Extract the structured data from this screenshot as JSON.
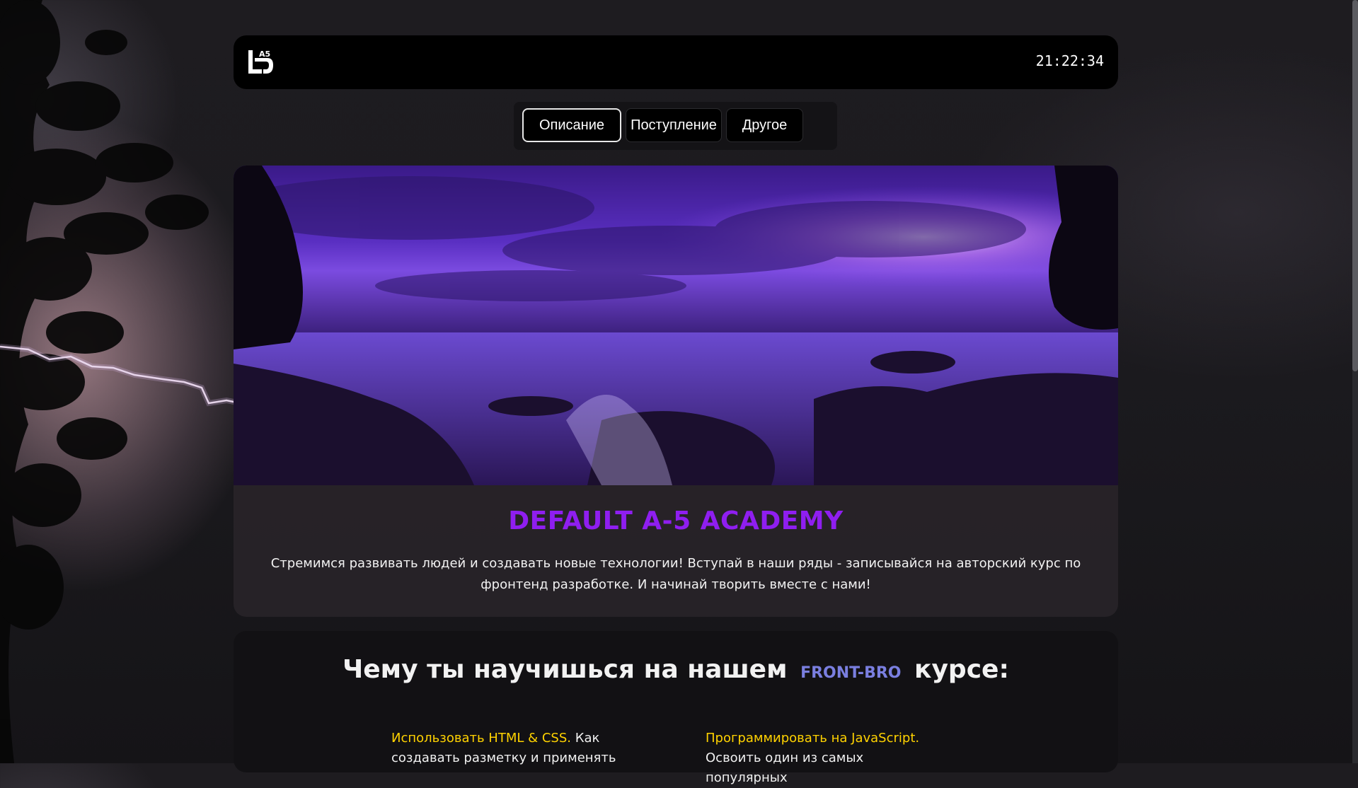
{
  "header": {
    "logo_icon": "a5-academy-logo-icon",
    "clock": "21:22:34"
  },
  "tabs": [
    {
      "label": "Описание",
      "active": true
    },
    {
      "label": "Поступление",
      "active": false
    },
    {
      "label": "Другое",
      "active": false
    }
  ],
  "hero": {
    "image": "purple-sunset-rocky-shore",
    "title": "DEFAULT A-5 ACADEMY",
    "text": "Стремимся развивать людей и создавать новые технологии! Вступай в наши ряды - записывайся на авторский курс по фронтенд разработке. И начинай творить вместе с нами!"
  },
  "learn": {
    "title_before": "Чему ты научишься на нашем",
    "title_accent": "FRONT-BRO",
    "title_after": "курсе:",
    "items": [
      {
        "highlight": "Использовать HTML & CSS.",
        "text": " Как создавать разметку и применять"
      },
      {
        "highlight": "Программировать на JavaScript.",
        "text": " Освоить один из самых популярных"
      }
    ]
  },
  "colors": {
    "accent_purple": "#8f1ef0",
    "accent_blue": "#7a7fe0",
    "highlight_yellow": "#ffd200"
  }
}
